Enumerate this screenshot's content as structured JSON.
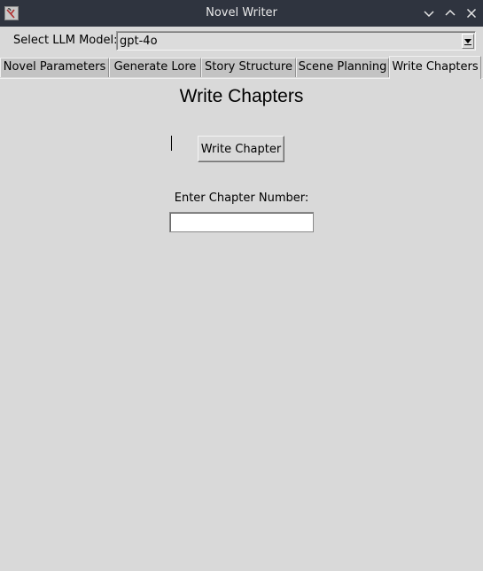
{
  "window": {
    "title": "Novel Writer",
    "icon": "app-icon",
    "controls": [
      "minimize-icon",
      "maximize-icon",
      "close-icon"
    ]
  },
  "model_selector": {
    "label": "Select LLM Model:",
    "selected": "gpt-4o"
  },
  "tabs": [
    {
      "label": "Novel Parameters"
    },
    {
      "label": "Generate Lore"
    },
    {
      "label": "Story Structure"
    },
    {
      "label": "Scene Planning"
    },
    {
      "label": "Write Chapters",
      "active": true
    }
  ],
  "main": {
    "heading": "Write Chapters",
    "write_button": "Write Chapter",
    "chapter_label": "Enter Chapter Number:",
    "chapter_value": ""
  },
  "colors": {
    "titlebar": "#2f343f",
    "background": "#d9d9d9",
    "inactive_tab": "#c3c3c3"
  }
}
